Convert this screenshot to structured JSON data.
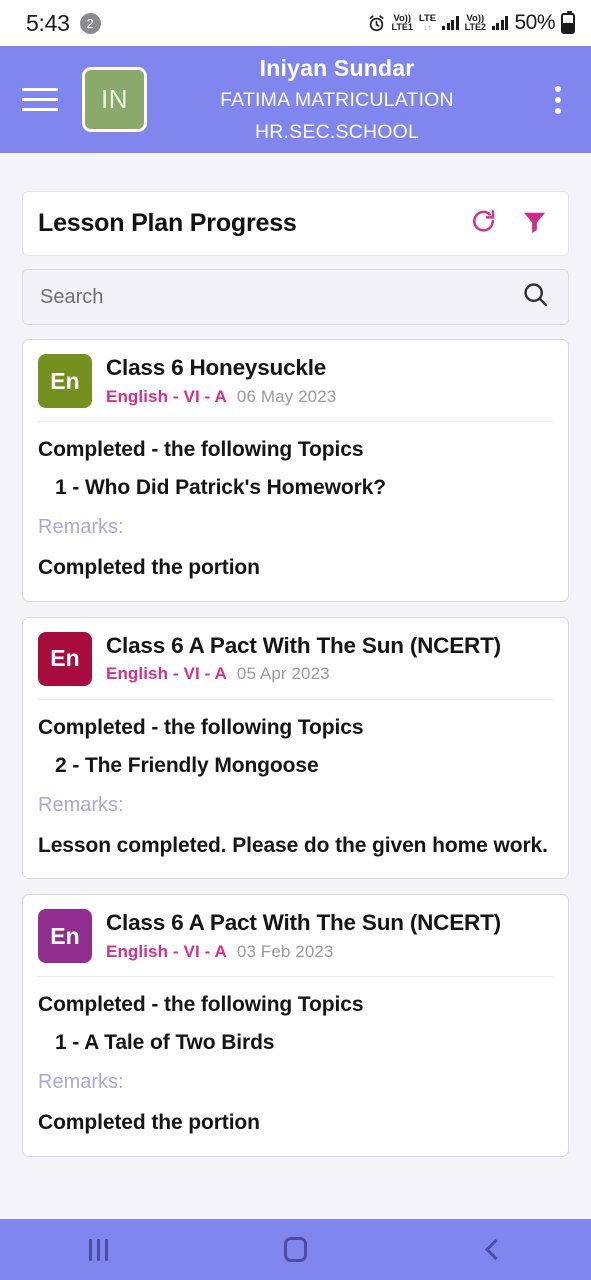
{
  "status_bar": {
    "time": "5:43",
    "notification_count": "2",
    "alarm_icon": "alarm-clock-icon",
    "sim1": {
      "volte": "Vo))",
      "label": "LTE1"
    },
    "network_type": "LTE",
    "data_arrows": "↓↑",
    "sim2": {
      "volte": "Vo))",
      "label": "LTE2"
    },
    "battery_percent": "50%"
  },
  "app_bar": {
    "menu_icon": "hamburger-menu-icon",
    "avatar_initials": "IN",
    "avatar_color": "#8aa96a",
    "user_name": "Iniyan Sundar",
    "school_line1": "FATIMA MATRICULATION",
    "school_line2": "HR.SEC.SCHOOL",
    "overflow_icon": "kebab-menu-icon",
    "background_color": "#8186ee"
  },
  "panel": {
    "title": "Lesson Plan Progress",
    "refresh_icon": "refresh-icon",
    "filter_icon": "filter-funnel-icon",
    "action_color": "#d6308f"
  },
  "search": {
    "value": "",
    "placeholder": "Search",
    "icon": "search-icon"
  },
  "labels": {
    "remarks": "Remarks:"
  },
  "cards": [
    {
      "badge_text": "En",
      "badge_color": "#74901f",
      "title": "Class 6 Honeysuckle",
      "class_info": "English - VI - A",
      "date": "06 May 2023",
      "status": "Completed - the following Topics",
      "topic": "1 - Who Did Patrick's Homework?",
      "remarks_label": "Remarks:",
      "remarks": "Completed the portion"
    },
    {
      "badge_text": "En",
      "badge_color": "#a80b3e",
      "title": "Class 6 A Pact With The Sun (NCERT)",
      "class_info": "English - VI - A",
      "date": "05 Apr 2023",
      "status": "Completed - the following Topics",
      "topic": "2 - The Friendly Mongoose",
      "remarks_label": "Remarks:",
      "remarks": "Lesson completed. Please do the given home work."
    },
    {
      "badge_text": "En",
      "badge_color": "#912d8f",
      "title": "Class 6 A Pact With The Sun (NCERT)",
      "class_info": "English - VI - A",
      "date": "03 Feb 2023",
      "status": "Completed - the following Topics",
      "topic": "1 - A Tale of Two Birds",
      "remarks_label": "Remarks:",
      "remarks": "Completed the portion"
    }
  ],
  "nav_bar": {
    "recents_icon": "recents-icon",
    "home_icon": "home-icon",
    "back_icon": "back-icon",
    "background_color": "#8186ee"
  }
}
